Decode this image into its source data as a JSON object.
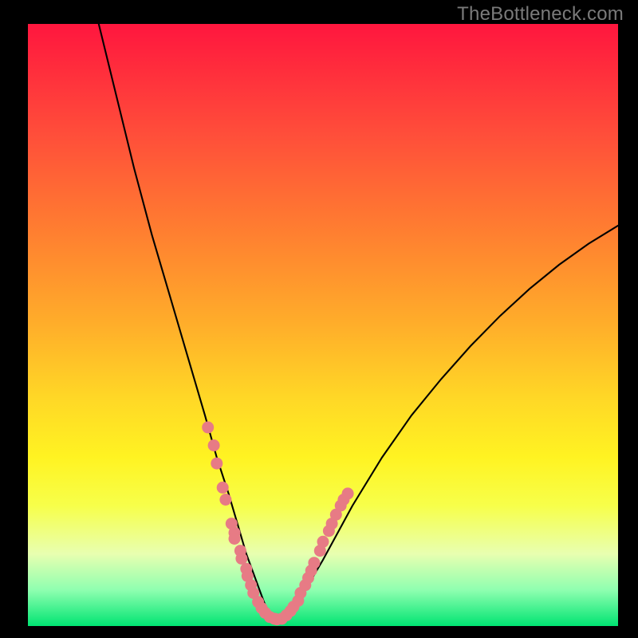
{
  "watermark": {
    "text": "TheBottleneck.com"
  },
  "chart_data": {
    "type": "line",
    "title": "",
    "xlabel": "",
    "ylabel": "",
    "xlim": [
      0,
      100
    ],
    "ylim": [
      0,
      100
    ],
    "series": [
      {
        "name": "curve",
        "x": [
          12,
          15,
          18,
          21,
          24,
          27,
          30,
          32,
          34,
          35.5,
          37,
          38.5,
          40,
          41,
          42,
          43.5,
          45,
          47,
          50,
          55,
          60,
          65,
          70,
          75,
          80,
          85,
          90,
          95,
          100
        ],
        "y": [
          100,
          88,
          76,
          65,
          55,
          45,
          35,
          28,
          22,
          17,
          12,
          8,
          4,
          2,
          1,
          1.5,
          3,
          6,
          11,
          20,
          28,
          35,
          41,
          46.5,
          51.5,
          56,
          60,
          63.5,
          66.5
        ]
      }
    ],
    "markers": {
      "name": "pink-dots",
      "color": "#e77b85",
      "points": [
        {
          "x": 30.5,
          "y": 33
        },
        {
          "x": 31.5,
          "y": 30
        },
        {
          "x": 32.0,
          "y": 27
        },
        {
          "x": 33.0,
          "y": 23
        },
        {
          "x": 33.5,
          "y": 21
        },
        {
          "x": 34.5,
          "y": 17
        },
        {
          "x": 35.0,
          "y": 15.5
        },
        {
          "x": 35.0,
          "y": 14.5
        },
        {
          "x": 36.0,
          "y": 12.5
        },
        {
          "x": 36.2,
          "y": 11.2
        },
        {
          "x": 37.0,
          "y": 9.5
        },
        {
          "x": 37.2,
          "y": 8.3
        },
        {
          "x": 37.8,
          "y": 6.8
        },
        {
          "x": 38.2,
          "y": 5.5
        },
        {
          "x": 39.0,
          "y": 4
        },
        {
          "x": 39.6,
          "y": 3
        },
        {
          "x": 40.2,
          "y": 2.2
        },
        {
          "x": 41.0,
          "y": 1.5
        },
        {
          "x": 41.8,
          "y": 1.2
        },
        {
          "x": 42.2,
          "y": 1.1
        },
        {
          "x": 43.0,
          "y": 1.2
        },
        {
          "x": 43.8,
          "y": 1.8
        },
        {
          "x": 44.5,
          "y": 2.5
        },
        {
          "x": 45.0,
          "y": 3.2
        },
        {
          "x": 45.8,
          "y": 4.2
        },
        {
          "x": 46.2,
          "y": 5.5
        },
        {
          "x": 47.0,
          "y": 6.8
        },
        {
          "x": 47.5,
          "y": 8
        },
        {
          "x": 48.0,
          "y": 9.2
        },
        {
          "x": 48.5,
          "y": 10.5
        },
        {
          "x": 49.5,
          "y": 12.5
        },
        {
          "x": 50.0,
          "y": 14
        },
        {
          "x": 51.0,
          "y": 15.8
        },
        {
          "x": 51.5,
          "y": 17
        },
        {
          "x": 52.2,
          "y": 18.5
        },
        {
          "x": 53.0,
          "y": 20
        },
        {
          "x": 53.5,
          "y": 21
        },
        {
          "x": 54.2,
          "y": 22
        }
      ]
    }
  }
}
